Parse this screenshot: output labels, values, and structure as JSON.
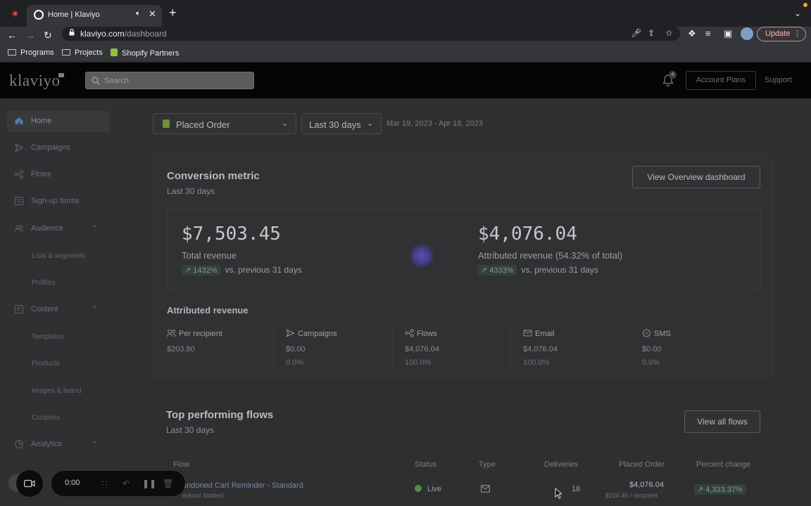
{
  "browser": {
    "tab_title": "Home | Klaviyo",
    "url_host": "klaviyo.com",
    "url_path": "/dashboard",
    "update_label": "Update",
    "bookmarks": [
      "Programs",
      "Projects",
      "Shopify Partners"
    ]
  },
  "app": {
    "logo": "klaviyo",
    "search_placeholder": "Search",
    "notification_count": "4",
    "account_plans_label": "Account Plans",
    "support_label": "Support"
  },
  "sidebar": {
    "items": [
      {
        "label": "Home"
      },
      {
        "label": "Campaigns"
      },
      {
        "label": "Flows"
      },
      {
        "label": "Sign-up forms"
      },
      {
        "label": "Audience"
      },
      {
        "label": "Lists & segments"
      },
      {
        "label": "Profiles"
      },
      {
        "label": "Content"
      },
      {
        "label": "Templates"
      },
      {
        "label": "Products"
      },
      {
        "label": "Images & brand"
      },
      {
        "label": "Coupons"
      },
      {
        "label": "Analytics"
      }
    ]
  },
  "filters": {
    "metric": "Placed Order",
    "period": "Last 30 days",
    "date_range": "Mar 19, 2023 - Apr 18, 2023"
  },
  "conversion": {
    "title": "Conversion metric",
    "subtitle": "Last 30 days",
    "button": "View Overview dashboard",
    "total_revenue": "$7,503.45",
    "total_label": "Total revenue",
    "total_delta": "1432%",
    "attributed_revenue": "$4,076.04",
    "attributed_label": "Attributed revenue (54.32% of total)",
    "attributed_delta": "4333%",
    "vs_text": "vs. previous 31 days",
    "section_title": "Attributed revenue",
    "metrics": [
      {
        "label": "Per recipient",
        "value": "$203.80",
        "pct": ""
      },
      {
        "label": "Campaigns",
        "value": "$0.00",
        "pct": "0.0%"
      },
      {
        "label": "Flows",
        "value": "$4,076.04",
        "pct": "100.0%"
      },
      {
        "label": "Email",
        "value": "$4,076.04",
        "pct": "100.0%"
      },
      {
        "label": "SMS",
        "value": "$0.00",
        "pct": "0.0%"
      }
    ]
  },
  "flows": {
    "title": "Top performing flows",
    "subtitle": "Last 30 days",
    "button": "View all flows",
    "columns": [
      "Flow",
      "Status",
      "Type",
      "Deliveries",
      "Placed Order",
      "Percent change"
    ],
    "row": {
      "name": "andoned Cart Reminder - Standard",
      "trigger": "eckout Started",
      "status": "Live",
      "deliveries": "18",
      "placed_order": "$4,076.04",
      "per_recipient": "$226.45 / recipient",
      "percent_change": "4,333.37%"
    }
  },
  "recorder": {
    "time": "0:00"
  }
}
